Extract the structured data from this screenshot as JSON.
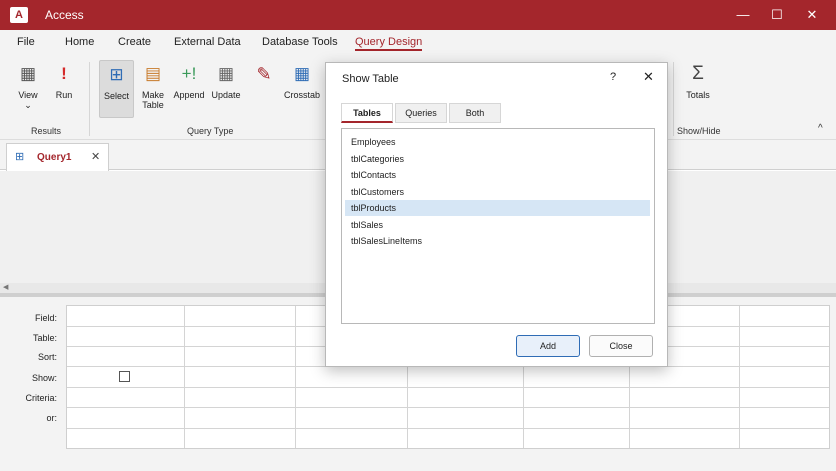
{
  "window": {
    "app_logo": "A",
    "title": "Access",
    "min_icon": "—",
    "max_icon": "☐",
    "close_icon": "✕"
  },
  "menu": {
    "tabs": [
      "File",
      "Home",
      "Create",
      "External Data",
      "Database Tools",
      "Query Design"
    ],
    "active": "Query Design"
  },
  "ribbon": {
    "buttons": [
      {
        "label": "View",
        "icon": "view-icon",
        "glyph": "▦",
        "extra": "⌄"
      },
      {
        "label": "Run",
        "icon": "run-icon",
        "glyph": "!"
      },
      {
        "label": "Select",
        "icon": "select-query-icon",
        "glyph": "⊞"
      },
      {
        "label": "Make",
        "label2": "Table",
        "icon": "make-table-icon",
        "glyph": "▤"
      },
      {
        "label": "Append",
        "icon": "append-icon",
        "glyph": "+!"
      },
      {
        "label": "Update",
        "icon": "update-icon",
        "glyph": "▦"
      },
      {
        "label": "Crosstab",
        "icon": "crosstab-icon",
        "glyph": "▦"
      },
      {
        "label": "Totals",
        "icon": "totals-icon",
        "glyph": "Σ"
      }
    ],
    "groups": [
      "Results",
      "Query Type",
      "Show/Hide"
    ],
    "collapse_icon": "^"
  },
  "document": {
    "tab_label": "Query1",
    "tab_icon": "query-icon",
    "close_icon": "✕"
  },
  "qbe_grid": {
    "row_labels": [
      "Field:",
      "Table:",
      "Sort:",
      "Show:",
      "Criteria:",
      "or:"
    ]
  },
  "dialog": {
    "title": "Show Table",
    "help_icon": "?",
    "close_icon": "✕",
    "tabs": [
      "Tables",
      "Queries",
      "Both"
    ],
    "active_tab": "Tables",
    "items": [
      "Employees",
      "tblCategories",
      "tblContacts",
      "tblCustomers",
      "tblProducts",
      "tblSales",
      "tblSalesLineItems"
    ],
    "selected_item": "tblProducts",
    "buttons": {
      "add": "Add",
      "close": "Close"
    }
  },
  "colors": {
    "accent": "#a4262c",
    "selection": "#d6e6f5",
    "button_border": "#2f6cb5"
  }
}
